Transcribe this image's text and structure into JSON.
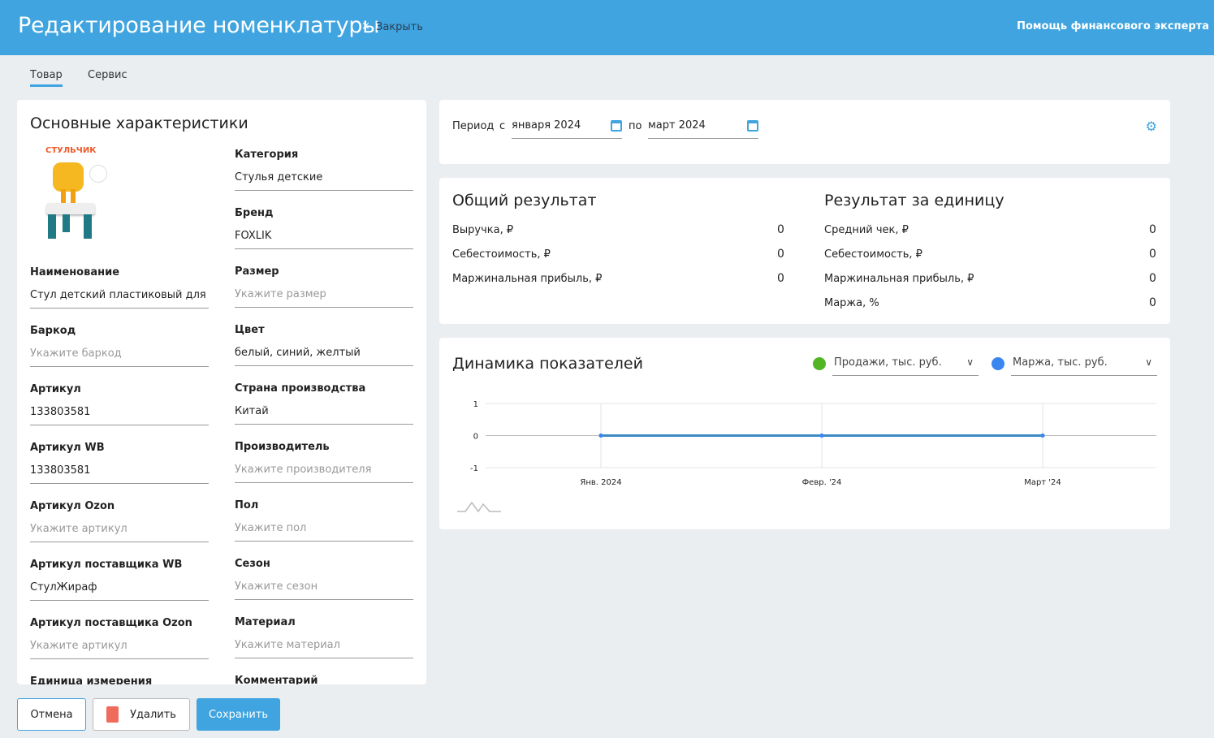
{
  "header": {
    "title": "Редактирование номенклатуры",
    "close_icon": "×",
    "close_label": "Закрыть",
    "help": "Помощь финансового эксперта"
  },
  "tabs": [
    {
      "label": "Товар",
      "active": true
    },
    {
      "label": "Сервис",
      "active": false
    }
  ],
  "main": {
    "title": "Основные характеристики",
    "image_text": "СТУЛЬЧИК",
    "left_fields": [
      {
        "label": "Наименование",
        "value": "Стул детский пластиковый для детей",
        "ph": false
      },
      {
        "label": "Баркод",
        "value": "Укажите баркод",
        "ph": true
      },
      {
        "label": "Артикул",
        "value": "133803581",
        "ph": false
      },
      {
        "label": "Артикул WB",
        "value": "133803581",
        "ph": false
      },
      {
        "label": "Артикул Ozon",
        "value": "Укажите артикул",
        "ph": true
      },
      {
        "label": "Артикул поставщика WB",
        "value": "СтулЖираф",
        "ph": false
      },
      {
        "label": "Артикул поставщика Ozon",
        "value": "Укажите артикул",
        "ph": true
      },
      {
        "label": "Единица измерения",
        "value": "",
        "ph": false
      }
    ],
    "right_fields": [
      {
        "label": "Категория",
        "value": "Стулья детские",
        "ph": false
      },
      {
        "label": "Бренд",
        "value": "FOXLIK",
        "ph": false
      },
      {
        "label": "Размер",
        "value": "Укажите размер",
        "ph": true
      },
      {
        "label": "Цвет",
        "value": "белый, синий, желтый",
        "ph": false
      },
      {
        "label": "Страна производства",
        "value": "Китай",
        "ph": false
      },
      {
        "label": "Производитель",
        "value": "Укажите производителя",
        "ph": true
      },
      {
        "label": "Пол",
        "value": "Укажите пол",
        "ph": true
      },
      {
        "label": "Сезон",
        "value": "Укажите сезон",
        "ph": true
      },
      {
        "label": "Материал",
        "value": "Укажите материал",
        "ph": true
      },
      {
        "label": "Комментарий",
        "value": "",
        "ph": false
      }
    ]
  },
  "period": {
    "label": "Период",
    "from": "с",
    "from_value": "января 2024",
    "to": "по",
    "to_value": "март 2024"
  },
  "results": {
    "total_title": "Общий результат",
    "total": [
      {
        "label": "Выручка, ₽",
        "value": "0"
      },
      {
        "label": "Себестоимость, ₽",
        "value": "0"
      },
      {
        "label": "Маржинальная прибыль, ₽",
        "value": "0"
      }
    ],
    "unit_title": "Результат за единицу",
    "unit": [
      {
        "label": "Средний чек, ₽",
        "value": "0"
      },
      {
        "label": "Себестоимость, ₽",
        "value": "0"
      },
      {
        "label": "Маржинальная прибыль, ₽",
        "value": "0"
      },
      {
        "label": "Маржа, %",
        "value": "0"
      }
    ]
  },
  "chart_data": {
    "type": "line",
    "title": "Динамика показателей",
    "categories": [
      "Янв. 2024",
      "Февр. '24",
      "Март '24"
    ],
    "series": [
      {
        "name": "Продажи, тыс. руб.",
        "color": "#52b526",
        "values": [
          0,
          0,
          0
        ]
      },
      {
        "name": "Маржа, тыс. руб.",
        "color": "#3a86f0",
        "values": [
          0,
          0,
          0
        ]
      }
    ],
    "yticks": [
      "1",
      "0",
      "-1"
    ],
    "ylim": [
      -1,
      1
    ],
    "grid": true
  },
  "buttons": {
    "cancel": "Отмена",
    "delete": "Удалить",
    "save": "Сохранить"
  }
}
